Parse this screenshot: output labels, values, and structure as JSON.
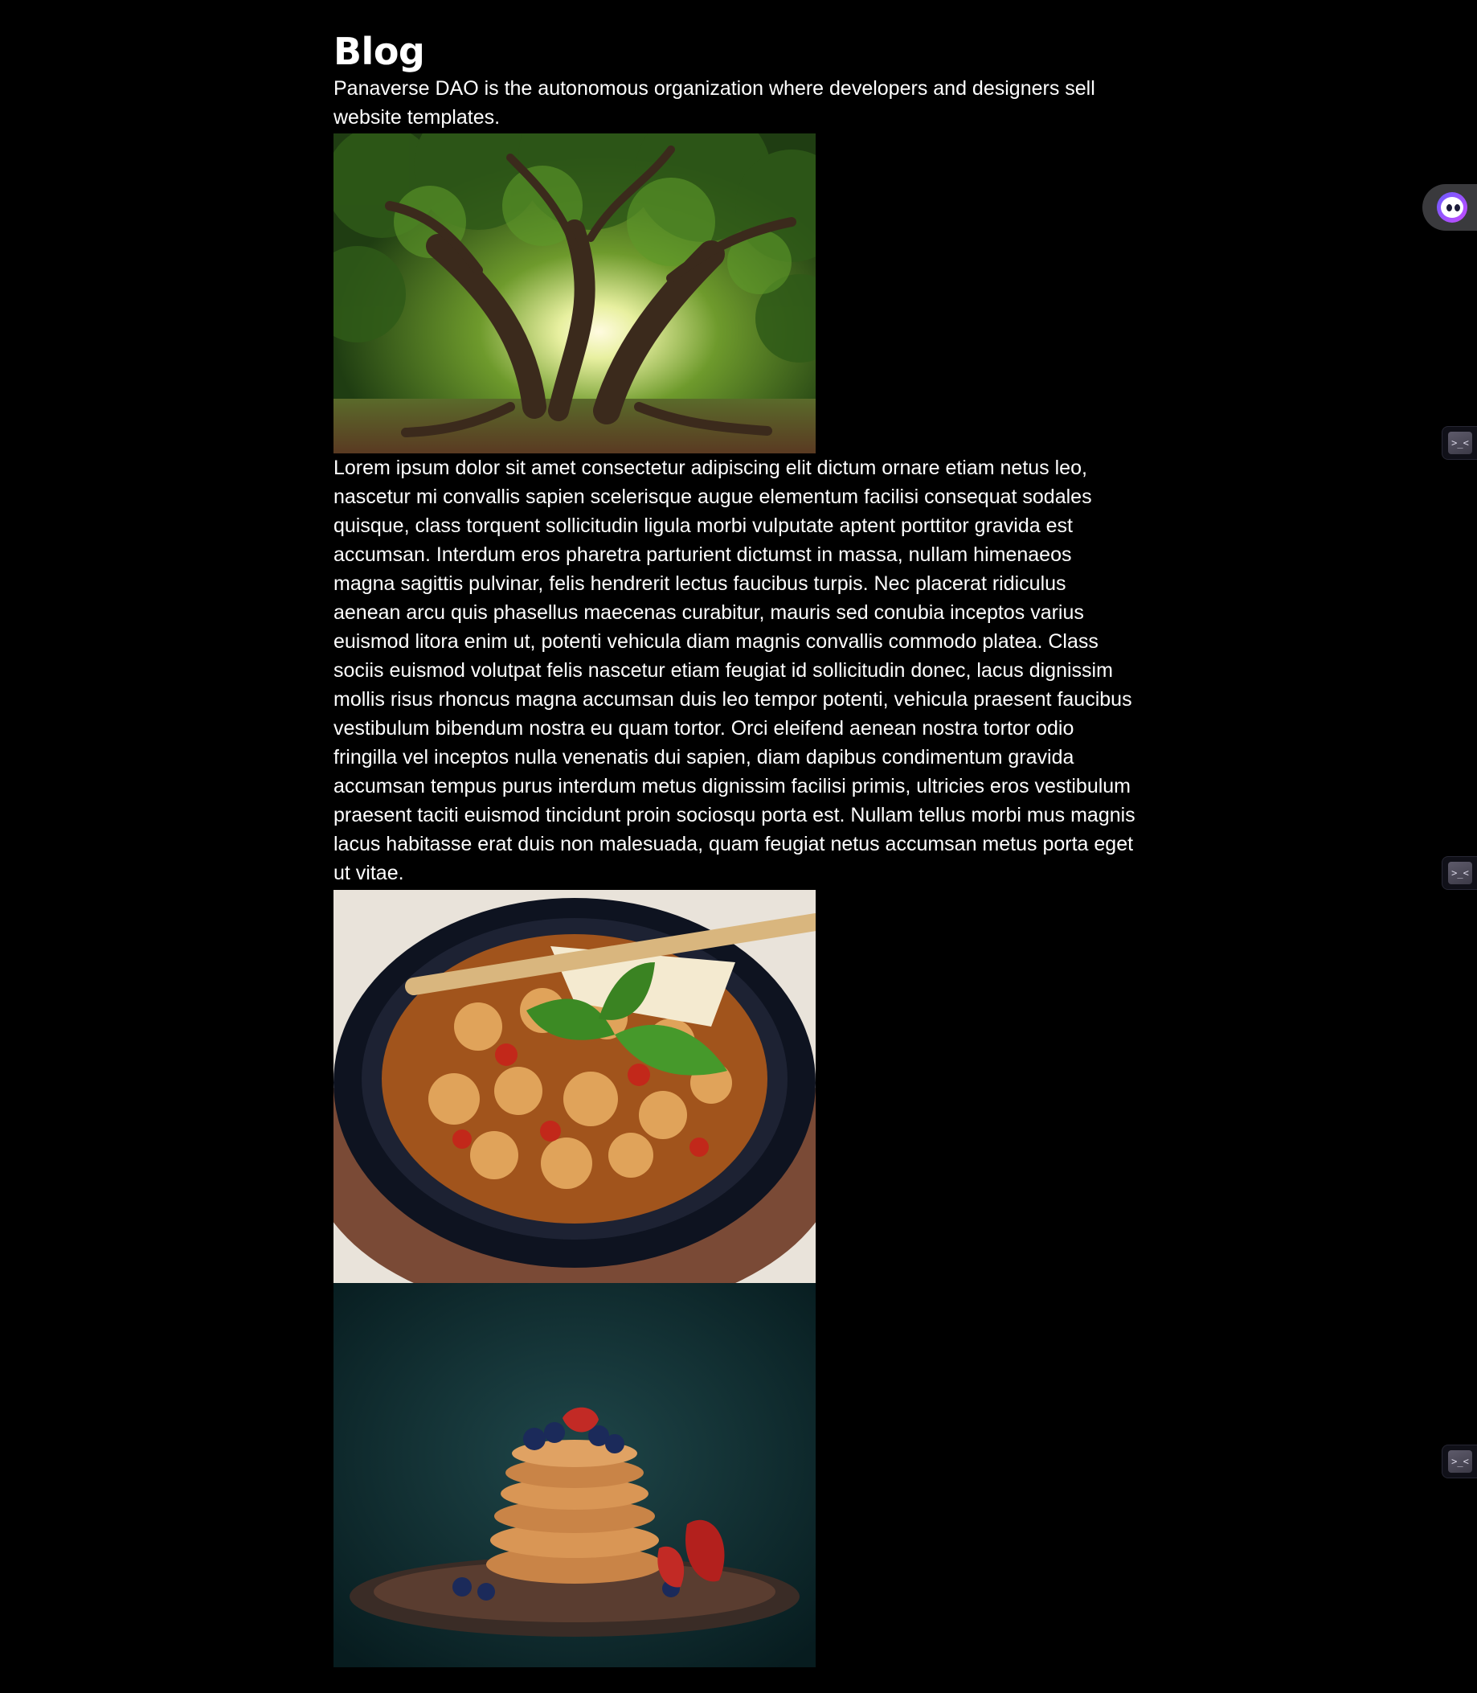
{
  "page": {
    "title": "Blog",
    "intro": "Panaverse DAO is the autonomous organization where developers and designers sell website templates.",
    "body": "Lorem ipsum dolor sit amet consectetur adipiscing elit dictum ornare etiam netus leo, nascetur mi convallis sapien scelerisque augue elementum facilisi consequat sodales quisque, class torquent sollicitudin ligula morbi vulputate aptent porttitor gravida est accumsan. Interdum eros pharetra parturient dictumst in massa, nullam himenaeos magna sagittis pulvinar, felis hendrerit lectus faucibus turpis. Nec placerat ridiculus aenean arcu quis phasellus maecenas curabitur, mauris sed conubia inceptos varius euismod litora enim ut, potenti vehicula diam magnis convallis commodo platea. Class sociis euismod volutpat felis nascetur etiam feugiat id sollicitudin donec, lacus dignissim mollis risus rhoncus magna accumsan duis leo tempor potenti, vehicula praesent faucibus vestibulum bibendum nostra eu quam tortor. Orci eleifend aenean nostra tortor odio fringilla vel inceptos nulla venenatis dui sapien, diam dapibus condimentum gravida accumsan tempus purus interdum metus dignissim facilisi primis, ultricies eros vestibulum praesent taciti euismod tincidunt proin sociosqu porta est. Nullam tellus morbi mus magnis lacus habitasse erat duis non malesuada, quam feugiat netus accumsan metus porta eget ut vitae."
  },
  "images": [
    {
      "subject": "tree-photo"
    },
    {
      "subject": "food-bowl-photo"
    },
    {
      "subject": "pancakes-photo"
    }
  ],
  "extensions": {
    "assistant_icon": "assistant-face-icon",
    "terminal_icon": "terminal-icon",
    "terminal_glyph": ">_<"
  },
  "colors": {
    "background": "#000000",
    "text": "#ffffff"
  }
}
